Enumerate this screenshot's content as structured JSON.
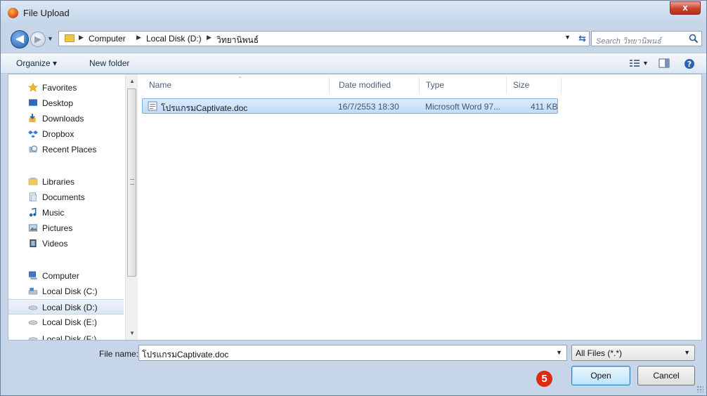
{
  "window": {
    "title": "File Upload",
    "close_glyph": "x"
  },
  "address": {
    "crumbs": [
      "Computer",
      "Local Disk (D:)",
      "วิทยานิพนธ์"
    ],
    "search_placeholder": "Search วิทยานิพนธ์"
  },
  "toolbar": {
    "organize": "Organize ▾",
    "new_folder": "New folder"
  },
  "nav": {
    "favorites": "Favorites",
    "favorites_items": [
      "Desktop",
      "Downloads",
      "Dropbox",
      "Recent Places"
    ],
    "libraries": "Libraries",
    "libraries_items": [
      "Documents",
      "Music",
      "Pictures",
      "Videos"
    ],
    "computer": "Computer",
    "computer_items": [
      "Local Disk (C:)",
      "Local Disk (D:)",
      "Local Disk (E:)",
      "Local Disk (F:)"
    ],
    "selected": "Local Disk (D:)"
  },
  "columns": {
    "name": "Name",
    "date": "Date modified",
    "type": "Type",
    "size": "Size"
  },
  "files": [
    {
      "name": "โปรแกรมCaptivate.doc",
      "date": "16/7/2553 18:30",
      "type": "Microsoft Word 97...",
      "size": "411 KB"
    }
  ],
  "footer": {
    "file_name_label": "File name:",
    "file_name_value": "โปรแกรมCaptivate.doc",
    "filter_value": "All Files (*.*)",
    "open_label": "Open",
    "cancel_label": "Cancel",
    "step_number": "5"
  },
  "colors": {
    "accent": "#1f5fb1",
    "badge": "#e02a10",
    "selection": "#c1dbfa"
  }
}
